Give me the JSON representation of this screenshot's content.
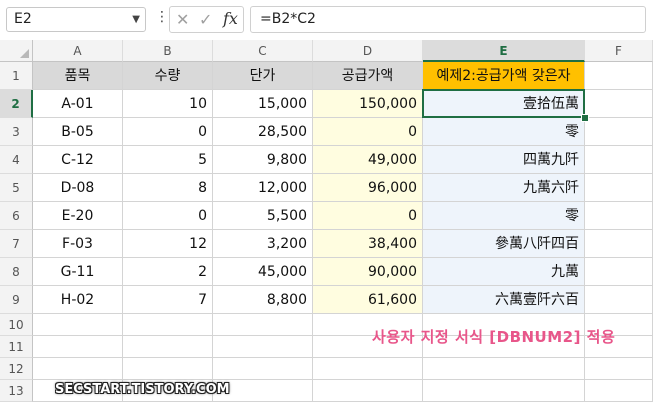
{
  "formula_bar": {
    "name_box": "E2",
    "formula": "=B2*C2",
    "cancel_icon": "✕",
    "enter_icon": "✓",
    "fx_label": "fx"
  },
  "columns": [
    "A",
    "B",
    "C",
    "D",
    "E",
    "F"
  ],
  "rows": [
    "1",
    "2",
    "3",
    "4",
    "5",
    "6",
    "7",
    "8",
    "9",
    "10",
    "11",
    "12",
    "13"
  ],
  "headers": {
    "a": "품목",
    "b": "수량",
    "c": "단가",
    "d": "공급가액",
    "e": "예제2:공급가액 갖은자"
  },
  "data_rows": [
    {
      "a": "A-01",
      "b": "10",
      "c": "15,000",
      "d": "150,000",
      "e": "壹拾伍萬"
    },
    {
      "a": "B-05",
      "b": "0",
      "c": "28,500",
      "d": "0",
      "e": "零"
    },
    {
      "a": "C-12",
      "b": "5",
      "c": "9,800",
      "d": "49,000",
      "e": "四萬九阡"
    },
    {
      "a": "D-08",
      "b": "8",
      "c": "12,000",
      "d": "96,000",
      "e": "九萬六阡"
    },
    {
      "a": "E-20",
      "b": "0",
      "c": "5,500",
      "d": "0",
      "e": "零"
    },
    {
      "a": "F-03",
      "b": "12",
      "c": "3,200",
      "d": "38,400",
      "e": "參萬八阡四百"
    },
    {
      "a": "G-11",
      "b": "2",
      "c": "45,000",
      "d": "90,000",
      "e": "九萬"
    },
    {
      "a": "H-02",
      "b": "7",
      "c": "8,800",
      "d": "61,600",
      "e": "六萬壹阡六百"
    }
  ],
  "annotation": "사용자 지정 서식 [DBNUM2] 적용",
  "watermark": "SECSTART.TISTORY.COM",
  "colors": {
    "header_fill": "#d9d9d9",
    "highlight_header": "#ffc000",
    "supply_column": "#fffde0",
    "result_column": "#eef4fb",
    "selection": "#1f6e43",
    "annotation": "#e8568a"
  }
}
